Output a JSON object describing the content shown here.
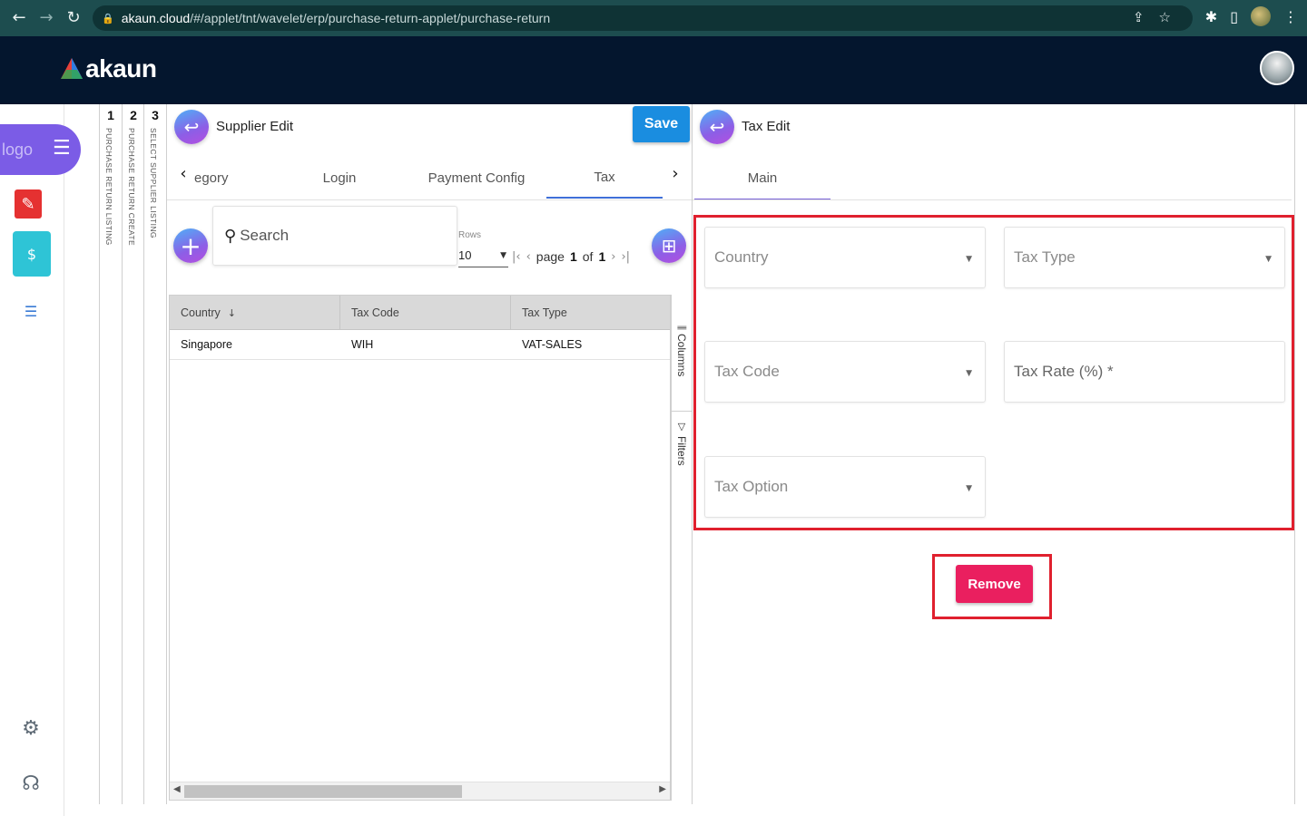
{
  "browser": {
    "url_domain": "akaun.cloud",
    "url_path": "/#/applet/tnt/wavelet/erp/purchase-return-applet/purchase-return"
  },
  "app": {
    "brand": "akaun",
    "logo_alt": "logo"
  },
  "breadcrumbs": [
    {
      "num": "1",
      "label": "PURCHASE RETURN LISTING"
    },
    {
      "num": "2",
      "label": "PURCHASE RETURN CREATE"
    },
    {
      "num": "3",
      "label": "SELECT SUPPLIER LISTING"
    }
  ],
  "supplier_panel": {
    "title": "Supplier Edit",
    "save_label": "Save",
    "tabs": [
      {
        "label": "egory"
      },
      {
        "label": "Login"
      },
      {
        "label": "Payment Config"
      },
      {
        "label": "Tax"
      }
    ],
    "search_placeholder": "Search",
    "rows_label": "Rows",
    "rows_value": "10",
    "pager": {
      "page_word": "page",
      "page": "1",
      "of_word": "of",
      "total": "1"
    },
    "grid": {
      "columns": [
        "Country",
        "Tax Code",
        "Tax Type"
      ],
      "rows": [
        [
          "Singapore",
          "WIH",
          "VAT-SALES"
        ]
      ]
    },
    "side_tabs": {
      "columns": "Columns",
      "filters": "Filters"
    }
  },
  "tax_panel": {
    "title": "Tax Edit",
    "tab": "Main",
    "fields": {
      "country": "Country",
      "tax_type": "Tax Type",
      "tax_code": "Tax Code",
      "tax_rate": "Tax Rate (%) *",
      "tax_option": "Tax Option"
    },
    "remove_label": "Remove"
  },
  "colors": {
    "header_bg": "#04162e",
    "browser_bg": "#1d4d4f",
    "accent_blue": "#1a8de0",
    "remove_red": "#ea1f5f",
    "highlight_red": "#e0202e"
  }
}
